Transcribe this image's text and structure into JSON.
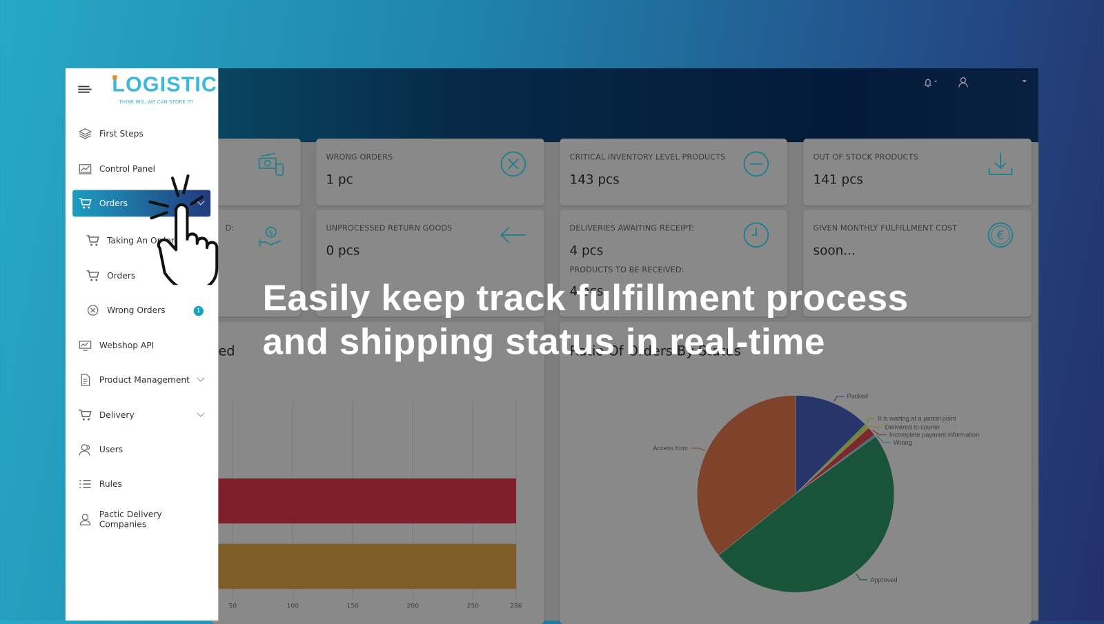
{
  "brand": {
    "logo": "LOGISTIC",
    "tagline": "THINK BIG, WE CAN STORE IT!"
  },
  "sidebar": {
    "items": [
      {
        "label": "First Steps",
        "icon": "layers-icon"
      },
      {
        "label": "Control Panel",
        "icon": "chart-screen-icon"
      },
      {
        "label": "Orders",
        "icon": "cart-icon",
        "active": true,
        "expanded": true
      },
      {
        "label": "Taking An Order",
        "icon": "cart-icon",
        "sub": true
      },
      {
        "label": "Orders",
        "icon": "cart-icon",
        "sub": true
      },
      {
        "label": "Wrong Orders",
        "icon": "x-circle-icon",
        "sub": true,
        "badge": "1"
      },
      {
        "label": "Webshop API",
        "icon": "monitor-icon"
      },
      {
        "label": "Product Management",
        "icon": "document-icon",
        "chevron": true
      },
      {
        "label": "Delivery",
        "icon": "cart-icon",
        "chevron": true
      },
      {
        "label": "Users",
        "icon": "users-icon"
      },
      {
        "label": "Rules",
        "icon": "list-icon"
      },
      {
        "label": "Pactic Delivery Companies",
        "icon": "delivery-person-icon"
      }
    ]
  },
  "header": {
    "icons": [
      "bell-icon",
      "user-icon"
    ]
  },
  "cards": {
    "partial_row1": {
      "icon": "money-icon"
    },
    "partial_row2": {
      "title_fragment": "D:",
      "icon": "hand-money-icon"
    },
    "wrong_orders": {
      "title": "WRONG ORDERS",
      "value": "1 pc",
      "icon": "x-circle-icon"
    },
    "critical_inventory": {
      "title": "CRITICAL INVENTORY LEVEL PRODUCTS",
      "value": "143 pcs",
      "icon": "minus-circle-icon"
    },
    "out_of_stock": {
      "title": "OUT OF STOCK PRODUCTS",
      "value": "141 pcs",
      "icon": "download-icon"
    },
    "unprocessed_returns": {
      "title": "UNPROCESSED RETURN GOODS",
      "value": "0 pcs",
      "icon": "arrow-left-icon"
    },
    "deliveries_awaiting": {
      "title": "DELIVERIES AWAITING RECEIPT:",
      "value": "4 pcs",
      "subtitle": "PRODUCTS TO BE RECEIVED:",
      "subvalue": "4 pcs",
      "icon": "clock-icon"
    },
    "fulfillment_cost": {
      "title": "GIVEN MONTHLY FULFILLMENT COST",
      "value": "soon...",
      "icon": "euro-circle-icon"
    }
  },
  "headline": {
    "line1": "Easily keep track fulfillment process",
    "line2": "and shipping status in real-time"
  },
  "chart_data": [
    {
      "type": "bar",
      "orientation": "horizontal",
      "title_fragment": "ed",
      "xticks": [
        "50",
        "100",
        "150",
        "200",
        "250",
        "286"
      ],
      "xlim": [
        38,
        286
      ],
      "grid": true,
      "series": [
        {
          "values": [
            286
          ],
          "color": "#7f1f2e"
        },
        {
          "values": [
            286
          ],
          "color": "#7f5e27"
        }
      ]
    },
    {
      "type": "pie",
      "title": "Ratio Of Orders By Status",
      "slices": [
        {
          "label": "Packed",
          "percent": 12.5,
          "color": "#26356a"
        },
        {
          "label": "It is waiting at a parcel point",
          "percent": 0.4,
          "color": "#5a8a2a"
        },
        {
          "label": "Delivered to courier",
          "percent": 0.4,
          "color": "#8c7a20"
        },
        {
          "label": "Incomplete payment information",
          "percent": 1.5,
          "color": "#7a2a2e"
        },
        {
          "label": "Wrong",
          "percent": 0.3,
          "color": "#2a6e80"
        },
        {
          "label": "Approved",
          "percent": 49.2,
          "color": "#18533a"
        },
        {
          "label": "Access from",
          "percent": 35.7,
          "color": "#7e432a"
        }
      ]
    }
  ]
}
